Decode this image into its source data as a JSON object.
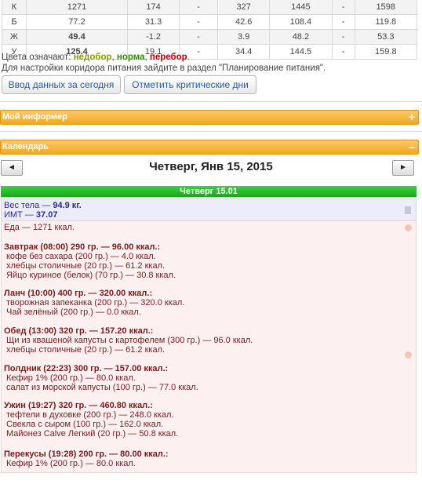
{
  "nutrients": [
    {
      "label": "К",
      "total": "1271",
      "min": "174",
      "max": "327",
      "min2": "1445",
      "max2": "1598",
      "status": "lack"
    },
    {
      "label": "Б",
      "total": "77.2",
      "min": "31.3",
      "max": "42.6",
      "min2": "108.4",
      "max2": "119.8",
      "status": "over"
    },
    {
      "label": "Ж",
      "total": "49.4",
      "min": "-1.2",
      "max": "3.9",
      "min2": "48.2",
      "max2": "53.3",
      "status": "norm"
    },
    {
      "label": "У",
      "total": "125.4",
      "min": "19.1",
      "max": "34.4",
      "min2": "144.5",
      "max2": "159.8",
      "status": "over"
    }
  ],
  "dash": "-",
  "legend": {
    "prefix": "Цвета означают: ",
    "lack": "недобор",
    "sep1": ", ",
    "norm": "норма",
    "sep2": ", ",
    "over": "перебор",
    "suffix": "."
  },
  "hint": "Для настройки коридора питания зайдите в раздел \"Планирование питания\".",
  "buttons": {
    "enter_today": "Ввод данных за сегодня",
    "mark_critical": "Отметить критические дни"
  },
  "informer": {
    "title": "Мой информер",
    "toggle": "+"
  },
  "calendar": {
    "title": "Календарь",
    "toggle": "–",
    "date_title": "Четверг, Янв 15, 2015",
    "prev": "◄",
    "next": "►",
    "day_bar": "Четверг 15.01"
  },
  "weight": {
    "weight_label": "Вес тела — ",
    "weight_value": "94.9 кг.",
    "bmi_label": "ИМТ — ",
    "bmi_value": "37.07"
  },
  "food": {
    "total": "Еда — 1271 ккал.",
    "meals": [
      {
        "header": "Завтрак (08:00) 290 гр. — 96.00 ккал.:",
        "items": [
          "кофе без сахара (200 гр.) — 4.0 ккал.",
          "хлебцы столичные (20 гр.) — 61.2 ккал.",
          "Яйцо куриное (белок) (70 гр.) — 30.8 ккал."
        ]
      },
      {
        "header": "Ланч (10:00) 400 гр. — 320.00 ккал.:",
        "items": [
          "творожная запеканка (200 гр.) — 320.0 ккал.",
          "Чай зелёный (200 гр.) — 0.0 ккал."
        ]
      },
      {
        "header": "Обед (13:00) 320 гр. — 157.20 ккал.:",
        "items": [
          "Щи из квашеной капусты с картофелем (300 гр.) — 96.0 ккал.",
          "хлебцы столичные (20 гр.) — 61.2 ккал."
        ]
      },
      {
        "header": "Полдник (22:23) 300 гр. — 157.00 ккал.:",
        "items": [
          "Кефир 1% (200 гр.) — 80.0 ккал.",
          "салат из морской капусты (100 гр.) — 77.0 ккал."
        ]
      },
      {
        "header": "Ужин (19:27) 320 гр. — 460.80 ккал.:",
        "items": [
          "тефтели в духовке (200 гр.) — 248.0 ккал.",
          "Свекла с сыром (100 гр.) — 162.0 ккал.",
          "Майонез Calve Легкий (20 гр.) — 50.8 ккал."
        ]
      },
      {
        "header": "Перекусы (19:28) 200 гр. — 80.00 ккал.:",
        "items": [
          "Кефир 1% (200 гр.) — 80.0 ккал."
        ]
      }
    ]
  }
}
